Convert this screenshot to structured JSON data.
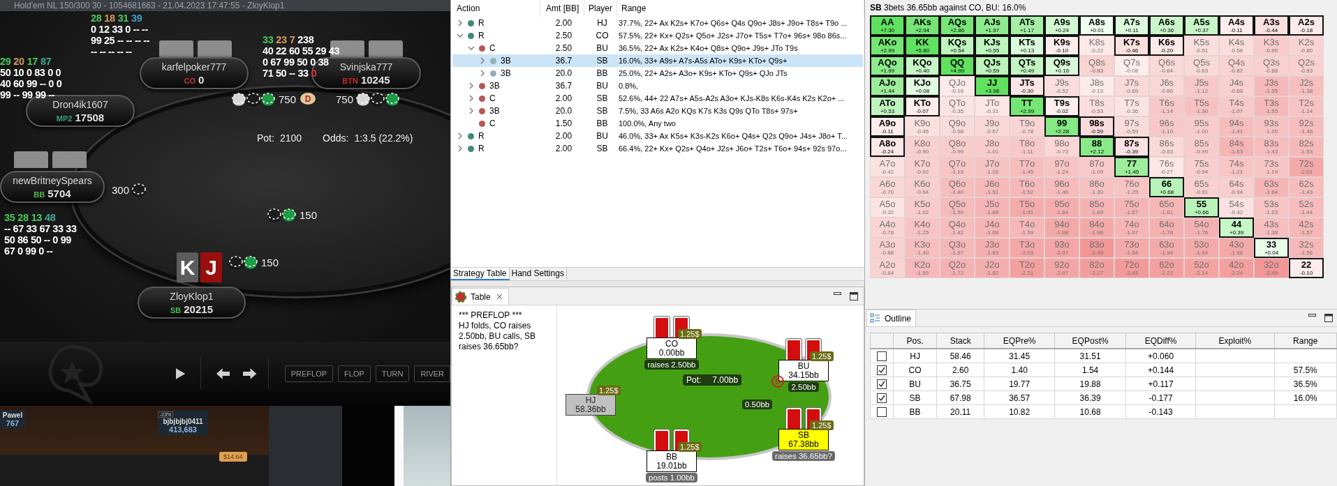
{
  "poker_client": {
    "window_title": "Hold'em NL 150/300 30 - 1054681663 - 21.04.2023 17:47:55 - ZloyKlop1",
    "huds": [
      {
        "stats": [
          {
            "value": "28",
            "color": "#4cc85a"
          },
          {
            "value": "18",
            "color": "#d79a5e"
          },
          {
            "value": "31",
            "color": "#4cc85a"
          },
          {
            "value": "39",
            "color": "#3fa0c8"
          }
        ],
        "lines": [
          "0 12 33 0 -- --",
          "99 25 -- -- -- --",
          "-- -- -- -- --"
        ]
      },
      {
        "stats": [
          {
            "value": "33",
            "color": "#4cc85a"
          },
          {
            "value": "23",
            "color": "#d79a5e"
          },
          {
            "value": "7",
            "color": "#d79a5e"
          },
          {
            "value": "238",
            "color": "#ffffff"
          }
        ],
        "lines": [
          "40 22 60 55 29 43",
          "0 67 99 50 0 38",
          "71 50 -- 33"
        ],
        "alert": "0"
      },
      {
        "stats": [
          {
            "value": "29",
            "color": "#4cc85a"
          },
          {
            "value": "20",
            "color": "#d79a5e"
          },
          {
            "value": "17",
            "color": "#4cc85a"
          },
          {
            "value": "87",
            "color": "#3fa89a"
          }
        ],
        "lines": [
          "50 10 0 83 0 0",
          "40 60 99 -- 0 0",
          "99 -- 99 99 --"
        ]
      },
      {
        "stats": [
          {
            "value": "35",
            "color": "#4cc85a"
          },
          {
            "value": "28",
            "color": "#4cc85a"
          },
          {
            "value": "13",
            "color": "#4cc85a"
          },
          {
            "value": "48",
            "color": "#3fa89a"
          }
        ],
        "lines": [
          "-- 67 33 67 33 33",
          "50 86 50 -- 0 99",
          "67 0 99 0 --"
        ]
      }
    ],
    "seats": [
      {
        "name": "karfelpoker777",
        "position": "CO",
        "color": "#d03434",
        "stack": "0",
        "card_backs": true
      },
      {
        "name": "Svinjska777",
        "position": "BTN",
        "color": "#c92a2a",
        "stack": "10245",
        "card_backs": true
      },
      {
        "name": "Dron4ik1607",
        "position": "MP2",
        "color": "#3fa08a",
        "stack": "17508",
        "card_backs": false
      },
      {
        "name": "newBritneySpears",
        "position": "BB",
        "color": "#4cb84c",
        "stack": "5704",
        "card_backs": true
      },
      {
        "name": "ZloyKlop1",
        "position": "SB",
        "color": "#4cb84c",
        "stack": "20215",
        "card_backs": false
      }
    ],
    "hero_cards": [
      {
        "rank": "K",
        "color": "#5c5c5c"
      },
      {
        "rank": "J",
        "color": "#9a0e0e"
      }
    ],
    "bets": [
      {
        "amount": "750"
      },
      {
        "amount": "750"
      },
      {
        "amount": "300"
      },
      {
        "amount": "150"
      },
      {
        "amount": "150"
      }
    ],
    "dealer_label": "D",
    "pot": {
      "label": "Pot:",
      "value": "2100"
    },
    "odds": {
      "label": "Odds:",
      "value": "1:3.5 (22.2%)"
    },
    "streets": [
      "PREFLOP",
      "FLOP",
      "TURN",
      "RIVER"
    ],
    "background_window": {
      "players": [
        {
          "name": "Pawel",
          "stack": "767"
        },
        {
          "name": "bjbjbjbj0411",
          "stack": "413,683",
          "badge": "-23%"
        }
      ],
      "tag": "$14.64"
    }
  },
  "strategy": {
    "columns": [
      "Action",
      "Amt [BB]",
      "Player",
      "Range"
    ],
    "rows": [
      {
        "action": "R",
        "amount": "2.00",
        "player": "HJ",
        "range": "37.7%, 22+ Ax K2s+ K7o+ Q6s+ Q4s Q9o+ J8s+ J9o+ T8s+ T9o ...",
        "color": "#3f8a6e",
        "expandable": true,
        "expanded": false,
        "selected": false
      },
      {
        "action": "R",
        "amount": "2.50",
        "player": "CO",
        "range": "57.5%, 22+ Kx+ Q2s+ Q5o+ J2s+ J7o+ T5s+ T7o+ 96s+ 98o 86s...",
        "color": "#3f8a6e",
        "expandable": true,
        "expanded": true,
        "selected": false,
        "children": [
          {
            "action": "C",
            "amount": "2.50",
            "player": "BU",
            "range": "36.5%, 22+ Ax K2s+ K4o+ Q8s+ Q9o+ J9s+ JTo T9s",
            "color": "#b95555",
            "expandable": true,
            "expanded": true,
            "selected": false,
            "children": [
              {
                "action": "3B",
                "amount": "36.7",
                "player": "SB",
                "range": "16.0%, 33+ A9s+ A7s-A5s ATo+ K9s+ KTo+ Q9s+",
                "color": "#8fb0b6",
                "expandable": true,
                "expanded": false,
                "selected": true
              },
              {
                "action": "3B",
                "amount": "20.0",
                "player": "BB",
                "range": "25.0%, 22+ A2s+ A3o+ K9s+ KTo+ Q9s+ QJo JTs",
                "color": "#8fb0b6",
                "expandable": true,
                "expanded": false,
                "selected": false
              }
            ]
          },
          {
            "action": "3B",
            "amount": "36.7",
            "player": "BU",
            "range": "0.8%,",
            "color": "#b95555",
            "expandable": true,
            "expanded": false,
            "selected": false
          },
          {
            "action": "C",
            "amount": "2.00",
            "player": "SB",
            "range": "52.6%, 44+ 22 A7s+ A5s-A2s A3o+ KJs-K8s K6s-K4s K2s K2o+ ...",
            "color": "#b95555",
            "expandable": true,
            "expanded": false,
            "selected": false
          },
          {
            "action": "3B",
            "amount": "20.0",
            "player": "SB",
            "range": "7.5%, 33 A6s A2o KQs K7s K3s Q9s QTo T8s+ 97s+",
            "color": "#b95555",
            "expandable": true,
            "expanded": false,
            "selected": false
          },
          {
            "action": "C",
            "amount": "1.50",
            "player": "BB",
            "range": "100.0%, Any two",
            "color": "#b95555",
            "selected": false
          }
        ]
      },
      {
        "action": "R",
        "amount": "2.00",
        "player": "BU",
        "range": "46.0%, 33+ Ax K5s+ K3s-K2s K6o+ Q4s+ Q2s Q9o+ J4s+ J8o+ T...",
        "color": "#3f8a6e",
        "expandable": true,
        "expanded": false,
        "selected": false
      },
      {
        "action": "R",
        "amount": "2.00",
        "player": "SB",
        "range": "66.4%, 22+ Kx+ Q2s+ Q4o+ J2s+ J6o+ T2s+ T6o+ 94s+ 92s 97o...",
        "color": "#3f8a6e",
        "expandable": true,
        "expanded": false,
        "selected": false
      }
    ],
    "tabs": [
      {
        "label": "Strategy Table",
        "selected": true
      },
      {
        "label": "Hand Settings",
        "selected": false
      }
    ]
  },
  "table_view": {
    "tab": "Table",
    "history": [
      "*** PREFLOP ***",
      "HJ folds, CO raises 2.50bb, BU calls, SB raises 36.65bb?"
    ],
    "seats": [
      {
        "position": "CO",
        "stack": "0.00bb",
        "bet": "1.25$",
        "folded": false,
        "acting": false,
        "cards": true,
        "action": {
          "text": "raises 2.50bb",
          "kind": "committed"
        }
      },
      {
        "position": "BU",
        "stack": "34.15bb",
        "bet": "1.25$",
        "folded": false,
        "acting": false,
        "cards": true,
        "dealer": true,
        "action": {
          "text": "2.50bb",
          "kind": "committed"
        }
      },
      {
        "position": "HJ",
        "stack": "58.36bb",
        "bet": "1.25$",
        "folded": true,
        "acting": false,
        "cards": false
      },
      {
        "position": "SB",
        "stack": "67.38bb",
        "bet": "1.25$",
        "folded": false,
        "acting": true,
        "cards": true,
        "action": {
          "text": "raises 36.65bb?",
          "kind": "pending"
        }
      },
      {
        "position": "BB",
        "stack": "19.01bb",
        "bet": "1.25$",
        "folded": false,
        "acting": false,
        "cards": true,
        "action": {
          "text": "posts 1.00bb",
          "kind": "pending"
        }
      }
    ],
    "dealer_label": "D",
    "pot": {
      "label": "Pot:",
      "value": "7.00bb"
    },
    "blind": "0.50bb"
  },
  "range_chart": {
    "title": "**SB** 3bets 36.65bb against CO, BU: 16.0%",
    "rows": [
      [
        {
          "hand": "AA",
          "ev": "+7.30",
          "in_range": true
        },
        {
          "hand": "AKs",
          "ev": "+2.94",
          "in_range": true
        },
        {
          "hand": "AQs",
          "ev": "+2.86",
          "in_range": true
        },
        {
          "hand": "AJs",
          "ev": "+1.97",
          "in_range": true
        },
        {
          "hand": "ATs",
          "ev": "+1.17",
          "in_range": true
        },
        {
          "hand": "A9s",
          "ev": "+0.24",
          "in_range": true
        },
        {
          "hand": "A8s",
          "ev": "+0.01",
          "in_range": true
        },
        {
          "hand": "A7s",
          "ev": "+0.11",
          "in_range": true
        },
        {
          "hand": "A6s",
          "ev": "+0.36",
          "in_range": true
        },
        {
          "hand": "A5s",
          "ev": "+0.37",
          "in_range": true
        },
        {
          "hand": "A4s",
          "ev": "-0.11",
          "in_range": true
        },
        {
          "hand": "A3s",
          "ev": "-0.44",
          "in_range": true
        },
        {
          "hand": "A2s",
          "ev": "-0.18",
          "in_range": true
        }
      ],
      [
        {
          "hand": "AKo",
          "ev": "+2.99",
          "in_range": true
        },
        {
          "hand": "KK",
          "ev": "+5.80",
          "in_range": true
        },
        {
          "hand": "KQs",
          "ev": "+0.54",
          "in_range": true
        },
        {
          "hand": "KJs",
          "ev": "+0.55",
          "in_range": true
        },
        {
          "hand": "KTs",
          "ev": "+0.13",
          "in_range": true
        },
        {
          "hand": "K9s",
          "ev": "-0.10",
          "in_range": true
        },
        {
          "hand": "K8s",
          "ev": "-0.22",
          "in_range": false
        },
        {
          "hand": "K7s",
          "ev": "-0.46",
          "in_range": true
        },
        {
          "hand": "K6s",
          "ev": "-0.20",
          "in_range": true
        },
        {
          "hand": "K5s",
          "ev": "-0.51",
          "in_range": false
        },
        {
          "hand": "K4s",
          "ev": "-0.56",
          "in_range": false
        },
        {
          "hand": "K3s",
          "ev": "-0.99",
          "in_range": false
        },
        {
          "hand": "K2s",
          "ev": "-0.80",
          "in_range": false
        }
      ],
      [
        {
          "hand": "AQo",
          "ev": "+1.99",
          "in_range": true
        },
        {
          "hand": "KQo",
          "ev": "+0.40",
          "in_range": true
        },
        {
          "hand": "QQ",
          "ev": "+4.99",
          "in_range": true
        },
        {
          "hand": "QJs",
          "ev": "+0.59",
          "in_range": true
        },
        {
          "hand": "QTs",
          "ev": "+0.49",
          "in_range": true
        },
        {
          "hand": "Q9s",
          "ev": "+0.16",
          "in_range": true
        },
        {
          "hand": "Q8s",
          "ev": "-0.83",
          "in_range": false
        },
        {
          "hand": "Q7s",
          "ev": "-0.08",
          "in_range": false
        },
        {
          "hand": "Q6s",
          "ev": "-0.64",
          "in_range": false
        },
        {
          "hand": "Q5s",
          "ev": "-0.63",
          "in_range": false
        },
        {
          "hand": "Q4s",
          "ev": "-0.82",
          "in_range": false
        },
        {
          "hand": "Q3s",
          "ev": "-0.88",
          "in_range": false
        },
        {
          "hand": "Q2s",
          "ev": "-0.93",
          "in_range": false
        }
      ],
      [
        {
          "hand": "AJo",
          "ev": "+1.44",
          "in_range": true
        },
        {
          "hand": "KJo",
          "ev": "+0.08",
          "in_range": true
        },
        {
          "hand": "QJo",
          "ev": "-0.16",
          "in_range": false
        },
        {
          "hand": "JJ",
          "ev": "+3.98",
          "in_range": true
        },
        {
          "hand": "JTs",
          "ev": "-0.30",
          "in_range": true
        },
        {
          "hand": "J9s",
          "ev": "-0.52",
          "in_range": false
        },
        {
          "hand": "J8s",
          "ev": "-0.13",
          "in_range": false
        },
        {
          "hand": "J7s",
          "ev": "-0.65",
          "in_range": false
        },
        {
          "hand": "J6s",
          "ev": "-0.66",
          "in_range": false
        },
        {
          "hand": "J5s",
          "ev": "-1.12",
          "in_range": false
        },
        {
          "hand": "J4s",
          "ev": "-0.88",
          "in_range": false
        },
        {
          "hand": "J3s",
          "ev": "-1.55",
          "in_range": false
        },
        {
          "hand": "J2s",
          "ev": "-1.38",
          "in_range": false
        }
      ],
      [
        {
          "hand": "ATo",
          "ev": "+0.53",
          "in_range": true
        },
        {
          "hand": "KTo",
          "ev": "-0.07",
          "in_range": true
        },
        {
          "hand": "QTo",
          "ev": "-0.35",
          "in_range": false
        },
        {
          "hand": "JTo",
          "ev": "-0.31",
          "in_range": false
        },
        {
          "hand": "TT",
          "ev": "+2.99",
          "in_range": true
        },
        {
          "hand": "T9s",
          "ev": "-0.02",
          "in_range": true
        },
        {
          "hand": "T8s",
          "ev": "-0.53",
          "in_range": false
        },
        {
          "hand": "T7s",
          "ev": "-0.36",
          "in_range": false
        },
        {
          "hand": "T6s",
          "ev": "-1.14",
          "in_range": false
        },
        {
          "hand": "T5s",
          "ev": "-1.30",
          "in_range": false
        },
        {
          "hand": "T4s",
          "ev": "-1.07",
          "in_range": false
        },
        {
          "hand": "T3s",
          "ev": "-1.55",
          "in_range": false
        },
        {
          "hand": "T2s",
          "ev": "-1.24",
          "in_range": false
        }
      ],
      [
        {
          "hand": "A9o",
          "ev": "-0.11",
          "in_range": true
        },
        {
          "hand": "K9o",
          "ev": "-0.45",
          "in_range": false
        },
        {
          "hand": "Q9o",
          "ev": "-0.58",
          "in_range": false
        },
        {
          "hand": "J9o",
          "ev": "-0.67",
          "in_range": false
        },
        {
          "hand": "T9o",
          "ev": "-0.78",
          "in_range": false
        },
        {
          "hand": "99",
          "ev": "+2.28",
          "in_range": true
        },
        {
          "hand": "98s",
          "ev": "-0.59",
          "in_range": true
        },
        {
          "hand": "97s",
          "ev": "-0.59",
          "in_range": false
        },
        {
          "hand": "96s",
          "ev": "-1.10",
          "in_range": false
        },
        {
          "hand": "95s",
          "ev": "-1.00",
          "in_range": false
        },
        {
          "hand": "94s",
          "ev": "-1.41",
          "in_range": false
        },
        {
          "hand": "93s",
          "ev": "-1.29",
          "in_range": false
        },
        {
          "hand": "92s",
          "ev": "-1.45",
          "in_range": false
        }
      ],
      [
        {
          "hand": "A8o",
          "ev": "-0.24",
          "in_range": true
        },
        {
          "hand": "K8o",
          "ev": "-0.90",
          "in_range": false
        },
        {
          "hand": "Q8o",
          "ev": "-0.99",
          "in_range": false
        },
        {
          "hand": "J8o",
          "ev": "-1.01",
          "in_range": false
        },
        {
          "hand": "T8o",
          "ev": "-1.11",
          "in_range": false
        },
        {
          "hand": "98o",
          "ev": "-0.73",
          "in_range": false
        },
        {
          "hand": "88",
          "ev": "+2.12",
          "in_range": true
        },
        {
          "hand": "87s",
          "ev": "-0.39",
          "in_range": true
        },
        {
          "hand": "86s",
          "ev": "-0.63",
          "in_range": false
        },
        {
          "hand": "85s",
          "ev": "-0.99",
          "in_range": false
        },
        {
          "hand": "84s",
          "ev": "-1.63",
          "in_range": false
        },
        {
          "hand": "83s",
          "ev": "-1.43",
          "in_range": false
        },
        {
          "hand": "82s",
          "ev": "-1.53",
          "in_range": false
        }
      ],
      [
        {
          "hand": "A7o",
          "ev": "-0.42",
          "in_range": false
        },
        {
          "hand": "K7o",
          "ev": "-0.92",
          "in_range": false
        },
        {
          "hand": "Q7o",
          "ev": "-1.19",
          "in_range": false
        },
        {
          "hand": "J7o",
          "ev": "-1.26",
          "in_range": false
        },
        {
          "hand": "T7o",
          "ev": "-1.45",
          "in_range": false
        },
        {
          "hand": "97o",
          "ev": "-1.24",
          "in_range": false
        },
        {
          "hand": "87o",
          "ev": "-1.09",
          "in_range": false
        },
        {
          "hand": "77",
          "ev": "+1.45",
          "in_range": true
        },
        {
          "hand": "76s",
          "ev": "-0.27",
          "in_range": false
        },
        {
          "hand": "75s",
          "ev": "-0.94",
          "in_range": false
        },
        {
          "hand": "74s",
          "ev": "-1.21",
          "in_range": false
        },
        {
          "hand": "73s",
          "ev": "-1.19",
          "in_range": false
        },
        {
          "hand": "72s",
          "ev": "-2.01",
          "in_range": false
        }
      ],
      [
        {
          "hand": "A6o",
          "ev": "-0.70",
          "in_range": false
        },
        {
          "hand": "K6o",
          "ev": "-0.94",
          "in_range": false
        },
        {
          "hand": "Q6o",
          "ev": "-1.40",
          "in_range": false
        },
        {
          "hand": "J6o",
          "ev": "-1.51",
          "in_range": false
        },
        {
          "hand": "T6o",
          "ev": "-1.52",
          "in_range": false
        },
        {
          "hand": "96o",
          "ev": "-1.46",
          "in_range": false
        },
        {
          "hand": "86o",
          "ev": "-1.30",
          "in_range": false
        },
        {
          "hand": "76o",
          "ev": "-1.25",
          "in_range": false
        },
        {
          "hand": "66",
          "ev": "+0.68",
          "in_range": true
        },
        {
          "hand": "65s",
          "ev": "-0.91",
          "in_range": false
        },
        {
          "hand": "64s",
          "ev": "-0.94",
          "in_range": false
        },
        {
          "hand": "63s",
          "ev": "-1.64",
          "in_range": false
        },
        {
          "hand": "62s",
          "ev": "-1.43",
          "in_range": false
        }
      ],
      [
        {
          "hand": "A5o",
          "ev": "-0.32",
          "in_range": false
        },
        {
          "hand": "K5o",
          "ev": "-1.02",
          "in_range": false
        },
        {
          "hand": "Q5o",
          "ev": "-1.50",
          "in_range": false
        },
        {
          "hand": "J5o",
          "ev": "-1.68",
          "in_range": false
        },
        {
          "hand": "T5o",
          "ev": "-1.91",
          "in_range": false
        },
        {
          "hand": "95o",
          "ev": "-1.84",
          "in_range": false
        },
        {
          "hand": "85o",
          "ev": "-1.69",
          "in_range": false
        },
        {
          "hand": "75o",
          "ev": "-1.67",
          "in_range": false
        },
        {
          "hand": "65o",
          "ev": "-1.61",
          "in_range": false
        },
        {
          "hand": "55",
          "ev": "+0.66",
          "in_range": true
        },
        {
          "hand": "54s",
          "ev": "-0.42",
          "in_range": false
        },
        {
          "hand": "53s",
          "ev": "-1.23",
          "in_range": false
        },
        {
          "hand": "52s",
          "ev": "-1.44",
          "in_range": false
        }
      ],
      [
        {
          "hand": "A4o",
          "ev": "-0.78",
          "in_range": false
        },
        {
          "hand": "K4o",
          "ev": "-1.25",
          "in_range": false
        },
        {
          "hand": "Q4o",
          "ev": "-1.42",
          "in_range": false
        },
        {
          "hand": "J4o",
          "ev": "-1.68",
          "in_range": false
        },
        {
          "hand": "T4o",
          "ev": "-1.59",
          "in_range": false
        },
        {
          "hand": "94o",
          "ev": "-1.98",
          "in_range": false
        },
        {
          "hand": "84o",
          "ev": "-1.98",
          "in_range": false
        },
        {
          "hand": "74o",
          "ev": "-1.67",
          "in_range": false
        },
        {
          "hand": "64o",
          "ev": "-1.78",
          "in_range": false
        },
        {
          "hand": "54o",
          "ev": "-1.76",
          "in_range": false
        },
        {
          "hand": "44",
          "ev": "+0.39",
          "in_range": true
        },
        {
          "hand": "43s",
          "ev": "-1.38",
          "in_range": false
        },
        {
          "hand": "42s",
          "ev": "-1.57",
          "in_range": false
        }
      ],
      [
        {
          "hand": "A3o",
          "ev": "-0.88",
          "in_range": false
        },
        {
          "hand": "K3o",
          "ev": "-1.40",
          "in_range": false
        },
        {
          "hand": "Q3o",
          "ev": "-1.57",
          "in_range": false
        },
        {
          "hand": "J3o",
          "ev": "-1.83",
          "in_range": false
        },
        {
          "hand": "T3o",
          "ev": "-2.03",
          "in_range": false
        },
        {
          "hand": "93o",
          "ev": "-2.07",
          "in_range": false
        },
        {
          "hand": "83o",
          "ev": "-2.49",
          "in_range": false
        },
        {
          "hand": "73o",
          "ev": "-1.94",
          "in_range": false
        },
        {
          "hand": "63o",
          "ev": "-1.94",
          "in_range": false
        },
        {
          "hand": "53o",
          "ev": "-1.94",
          "in_range": false
        },
        {
          "hand": "43o",
          "ev": "-1.96",
          "in_range": false
        },
        {
          "hand": "33",
          "ev": "+0.04",
          "in_range": true
        },
        {
          "hand": "32s",
          "ev": "-1.56",
          "in_range": false
        }
      ],
      [
        {
          "hand": "A2o",
          "ev": "-0.84",
          "in_range": false
        },
        {
          "hand": "K2o",
          "ev": "-1.55",
          "in_range": false
        },
        {
          "hand": "Q2o",
          "ev": "-1.72",
          "in_range": false
        },
        {
          "hand": "J2o",
          "ev": "-1.82",
          "in_range": false
        },
        {
          "hand": "T2o",
          "ev": "-2.21",
          "in_range": false
        },
        {
          "hand": "92o",
          "ev": "-2.07",
          "in_range": false
        },
        {
          "hand": "82o",
          "ev": "-2.27",
          "in_range": false
        },
        {
          "hand": "72o",
          "ev": "-2.43",
          "in_range": false
        },
        {
          "hand": "62o",
          "ev": "-2.22",
          "in_range": false
        },
        {
          "hand": "52o",
          "ev": "-2.14",
          "in_range": false
        },
        {
          "hand": "42o",
          "ev": "-2.24",
          "in_range": false
        },
        {
          "hand": "32o",
          "ev": "-2.49",
          "in_range": false
        },
        {
          "hand": "22",
          "ev": "-0.10",
          "in_range": true
        }
      ]
    ]
  },
  "outline": {
    "tab": "Outline",
    "columns": [
      "Pos.",
      "Stack",
      "EQPre%",
      "EQPost%",
      "EQDiff%",
      "Exploit%",
      "Range"
    ],
    "rows": [
      {
        "checked": false,
        "pos": "HJ",
        "stack": "58.46",
        "eq_pre": "31.45",
        "eq_post": "31.51",
        "eq_diff": "+0.060"
      },
      {
        "checked": true,
        "pos": "CO",
        "stack": "2.60",
        "eq_pre": "1.40",
        "eq_post": "1.54",
        "eq_diff": "+0.144",
        "range": "57.5%"
      },
      {
        "checked": true,
        "pos": "BU",
        "stack": "36.75",
        "eq_pre": "19.77",
        "eq_post": "19.88",
        "eq_diff": "+0.117",
        "range": "36.5%"
      },
      {
        "checked": true,
        "pos": "SB",
        "stack": "67.98",
        "eq_pre": "36.57",
        "eq_post": "36.39",
        "eq_diff": "-0.177",
        "range": "16.0%"
      },
      {
        "checked": false,
        "pos": "BB",
        "stack": "20.11",
        "eq_pre": "10.82",
        "eq_post": "10.68",
        "eq_diff": "-0.143"
      }
    ]
  }
}
